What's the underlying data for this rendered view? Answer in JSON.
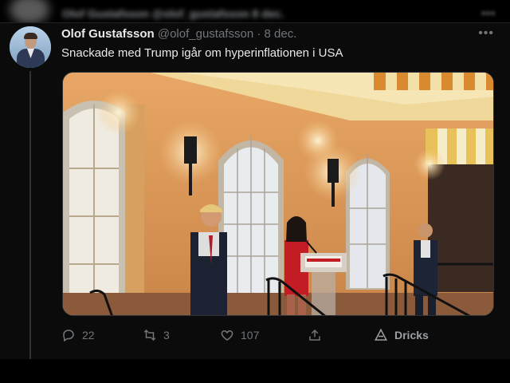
{
  "previous_tweet": {
    "name": "Olof Gustafsson",
    "handle": "@olof_gustafsson",
    "date": "8 dec."
  },
  "tweet": {
    "author_name": "Olof Gustafsson",
    "author_handle": "@olof_gustafsson",
    "separator": "·",
    "date": "8 dec.",
    "text": "Snackade med Trump igår om hyperinflationen i USA",
    "more_icon": "more-horizontal-icon",
    "media_alt": "Photo of Trump standing beside a woman speaking at a podium in an ornate hall"
  },
  "actions": {
    "reply_count": "22",
    "retweet_count": "3",
    "like_count": "107",
    "share_icon": "share-icon",
    "tip_label": "Dricks"
  },
  "colors": {
    "background": "#000000",
    "text": "#e7e9ea",
    "muted": "#71767b"
  }
}
